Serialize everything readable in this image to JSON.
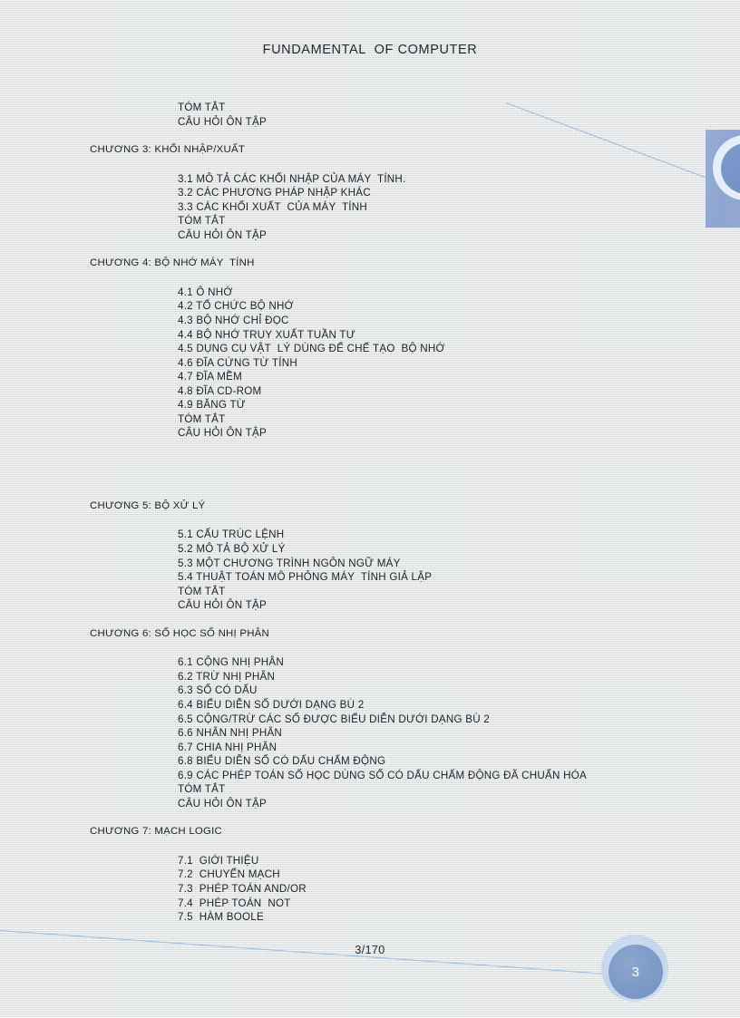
{
  "document": {
    "header_title": "FUNDAMENTAL  OF COMPUTER",
    "footer_page": "3/170",
    "badge_number": "3"
  },
  "colors": {
    "paper": "#ddeff8",
    "text": "#1d2124",
    "emblem_block": "#93a9d2",
    "badge_disc": "#7d9ac7",
    "hairline": "#8fb3dd"
  },
  "toc": {
    "continued_entries": [
      "TÓM TẮT",
      "CÂU HỎI ÔN TẬP"
    ],
    "chapters": [
      {
        "heading": "CHƯƠNG 3: KHỐI NHẬP/XUẤT",
        "entries": [
          "3.1 MÔ TẢ CÁC KHỐI NHẬP CỦA MÁY  TÍNH.",
          "3.2 CÁC PHƯƠNG PHÁP NHẬP KHÁC",
          "3.3 CÁC KHỐI XUẤT  CỦA MÁY  TÍNH"
        ],
        "tail": [
          "TÓM TẮT",
          "CÂU HỎI ÔN TẬP"
        ]
      },
      {
        "heading": "CHƯƠNG 4: BỘ NHỚ MÁY  TÍNH",
        "entries": [
          "4.1 Ô NHỚ",
          "4.2 TỔ CHỨC BỘ NHỚ",
          "4.3 BỘ NHỚ CHỈ ĐỌC",
          "4.4 BỘ NHỚ TRUY XUẤT TUẦN TƯ",
          "4.5 DỤNG CỤ VẬT  LÝ DÙNG ĐỂ CHẾ TẠO  BỘ NHỚ",
          "4.6 ĐĨA CỨNG TỪ TÍNH",
          "4.7 ĐĨA MỀM",
          "4.8 ĐĨA CD-ROM",
          "4.9 BĂNG TỪ"
        ],
        "tail": [
          "TÓM TẮT",
          "CÂU HỎI ÔN TẬP"
        ]
      },
      {
        "heading": "CHƯƠNG 5: BỘ XỬ LÝ",
        "entries": [
          "5.1 CẤU TRÚC LỆNH",
          "5.2 MÔ TẢ BỘ XỬ LÝ",
          "5.3 MỘT CHƯƠNG TRÌNH NGÔN NGỮ MÁY",
          "5.4 THUẬT TOÁN MÔ PHỎNG MÁY  TÍNH GIẢ LẬP"
        ],
        "tail": [
          "TÓM TẮT",
          "CÂU HỎI ÔN TẬP"
        ]
      },
      {
        "heading": "CHƯƠNG 6: SỐ HỌC SỐ NHỊ PHÂN",
        "entries": [
          "6.1 CỘNG NHỊ PHÂN",
          "6.2 TRỪ NHỊ PHÂN",
          "6.3 SỐ CÓ DẤU",
          "6.4 BIỂU DIỄN SỐ DƯỚI DẠNG BÙ 2",
          "6.5 CỘNG/TRỪ CÁC SỐ ĐƯỢC BIỂU DIỄN DƯỚI DẠNG BÙ 2",
          "6.6 NHÂN NHỊ PHÂN",
          "6.7 CHIA NHỊ PHÂN",
          "6.8 BIỂU DIỄN SỐ CÓ DẤU CHẤM ĐỘNG",
          "6.9 CÁC PHÉP TOÁN SỐ HỌC DÙNG SỐ CÓ DẤU CHẤM ĐỘNG ĐÃ CHUẨN HÓA"
        ],
        "tail": [
          "TÓM TẮT",
          "CÂU HỎI ÔN TẬP"
        ]
      },
      {
        "heading": "CHƯƠNG 7: MẠCH LOGIC",
        "entries": [
          "7.1  GIỚI THIỆU",
          "7.2  CHUYỂN MẠCH",
          "7.3  PHÉP TOÁN AND/OR",
          "7.4  PHÉP TOÁN  NOT",
          "7.5  HÀM BOOLE"
        ],
        "tail": []
      }
    ]
  }
}
